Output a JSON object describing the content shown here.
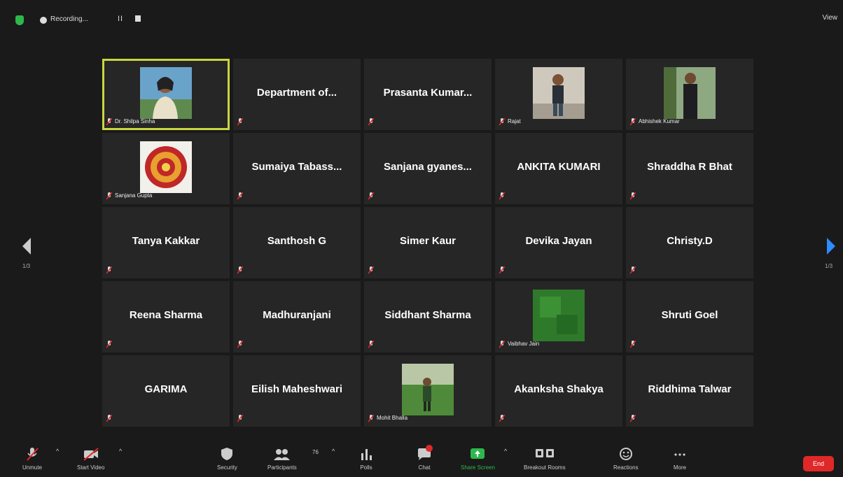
{
  "topbar": {
    "recording_label": "Recording...",
    "pause_symbol": "II",
    "view_label": "View"
  },
  "tiles": [
    {
      "name": "Dr. Shilpa Sinha",
      "type": "photo",
      "photo": "portrait-woman",
      "active": true
    },
    {
      "name": "Department of...",
      "type": "name"
    },
    {
      "name": "Prasanta Kumar...",
      "type": "name"
    },
    {
      "name": "Rajat",
      "type": "photo",
      "photo": "portrait-man"
    },
    {
      "name": "Abhishek Kumar",
      "type": "photo",
      "photo": "portrait-man-dark"
    },
    {
      "name": "Sanjana Gupta",
      "type": "photo",
      "photo": "emblem-logo"
    },
    {
      "name": "Sumaiya Tabass...",
      "type": "name"
    },
    {
      "name": "Sanjana gyanes...",
      "type": "name"
    },
    {
      "name": "ANKITA KUMARI",
      "type": "name"
    },
    {
      "name": "Shraddha R Bhat",
      "type": "name"
    },
    {
      "name": "Tanya Kakkar",
      "type": "name"
    },
    {
      "name": "Santhosh G",
      "type": "name"
    },
    {
      "name": "Simer Kaur",
      "type": "name"
    },
    {
      "name": "Devika Jayan",
      "type": "name"
    },
    {
      "name": "Christy.D",
      "type": "name"
    },
    {
      "name": "Reena Sharma",
      "type": "name"
    },
    {
      "name": "Madhuranjani",
      "type": "name"
    },
    {
      "name": "Siddhant Sharma",
      "type": "name"
    },
    {
      "name": "Vaibhav Jain",
      "type": "photo",
      "photo": "green-square"
    },
    {
      "name": "Shruti Goel",
      "type": "name"
    },
    {
      "name": "GARIMA",
      "type": "name"
    },
    {
      "name": "Eilish Maheshwari",
      "type": "name"
    },
    {
      "name": "Mohit Bhalla",
      "type": "photo",
      "photo": "portrait-outdoor"
    },
    {
      "name": "Akanksha Shakya",
      "type": "name"
    },
    {
      "name": "Riddhima Talwar",
      "type": "name"
    }
  ],
  "nav": {
    "left_page": "1/3",
    "right_page": "1/3"
  },
  "toolbar": {
    "items": [
      {
        "label": "Unmute",
        "icon": "mic-muted-icon"
      },
      {
        "label": "Start Video",
        "icon": "video-off-icon"
      },
      {
        "label": "Security",
        "icon": "shield-icon"
      },
      {
        "label": "Participants",
        "icon": "participants-icon"
      },
      {
        "label": "Polls",
        "icon": "polls-icon"
      },
      {
        "label": "Chat",
        "icon": "chat-icon"
      },
      {
        "label": "Share Screen",
        "icon": "share-screen-icon"
      },
      {
        "label": "Breakout Rooms",
        "icon": "breakout-rooms-icon"
      },
      {
        "label": "Reactions",
        "icon": "reactions-icon"
      },
      {
        "label": "More",
        "icon": "more-icon"
      }
    ],
    "participants_count": "76",
    "end_label": "End"
  },
  "colors": {
    "accent_active": "#c9d640",
    "share_green": "#2db84d",
    "end_red": "#e02828",
    "nav_blue": "#2d8cff"
  }
}
